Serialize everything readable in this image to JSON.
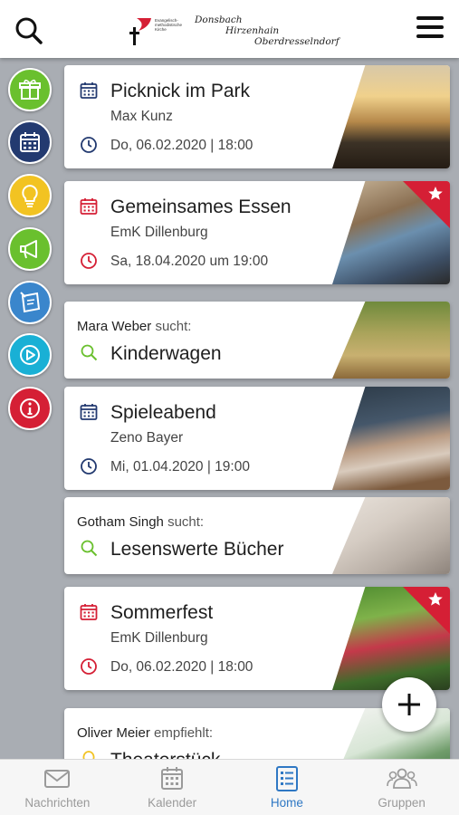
{
  "header": {
    "logo_church": "Evangelisch-methodistische Kirche",
    "logo_lines": [
      "Donsbach",
      "Hirzenhain",
      "Oberdresselndorf"
    ]
  },
  "rail": [
    {
      "name": "gifts",
      "color": "#6ac02e"
    },
    {
      "name": "calendar",
      "color": "#233a70"
    },
    {
      "name": "ideas",
      "color": "#f2c322"
    },
    {
      "name": "announcements",
      "color": "#6ac02e"
    },
    {
      "name": "notes",
      "color": "#3a86cc"
    },
    {
      "name": "media",
      "color": "#19b0d5"
    },
    {
      "name": "info",
      "color": "#d51f35"
    }
  ],
  "feed": {
    "event1": {
      "title": "Picknick im Park",
      "sub": "Max Kunz",
      "date": "Do, 06.02.2020 | 18:00",
      "accent": "#233a70"
    },
    "event2": {
      "title": "Gemeinsames Essen",
      "sub": "EmK Dillenburg",
      "date": "Sa, 18.04.2020 um 19:00",
      "accent": "#d51f35"
    },
    "search1": {
      "who": "Mara Weber",
      "verb": "sucht:",
      "what": "Kinderwagen"
    },
    "event3": {
      "title": "Spieleabend",
      "sub": "Zeno Bayer",
      "date": "Mi, 01.04.2020 | 19:00",
      "accent": "#233a70"
    },
    "search2": {
      "who": "Gotham Singh",
      "verb": "sucht:",
      "what": "Lesenswerte Bücher"
    },
    "event4": {
      "title": "Sommerfest",
      "sub": "EmK Dillenburg",
      "date": "Do, 06.02.2020 | 18:00",
      "accent": "#d51f35"
    },
    "recommend": {
      "who": "Oliver Meier",
      "verb": "empfiehlt:",
      "what": "Theaterstück"
    }
  },
  "tabs": [
    {
      "label": "Nachrichten"
    },
    {
      "label": "Kalender"
    },
    {
      "label": "Home",
      "active": true
    },
    {
      "label": "Gruppen"
    }
  ]
}
